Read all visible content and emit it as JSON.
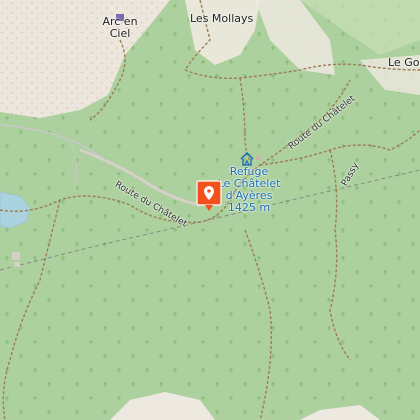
{
  "map": {
    "colors": {
      "forest": "#add19e",
      "rock": "#ede6dd",
      "water": "#aad3df",
      "path": "#9e7b52",
      "marker": "#f4511e",
      "poi_label": "#1f6fb5"
    },
    "place_labels": {
      "arc_en_ciel_line1": "Arc en",
      "arc_en_ciel_line2": "Ciel",
      "les_mollays": "Les Mollays",
      "le_gou": "Le Gou"
    },
    "roads": {
      "route_du_chatelet_west": "Route du Châtelet",
      "route_du_chatelet_east": "Route du Châtelet",
      "passy": "Passy"
    },
    "refuge": {
      "name_line1": "Refuge",
      "name_line2": "Le Châtelet",
      "name_line3": "d'Ayères",
      "elevation": "1425 m",
      "icon": "shelter-icon"
    },
    "marker_icon": "map-pin-icon"
  }
}
